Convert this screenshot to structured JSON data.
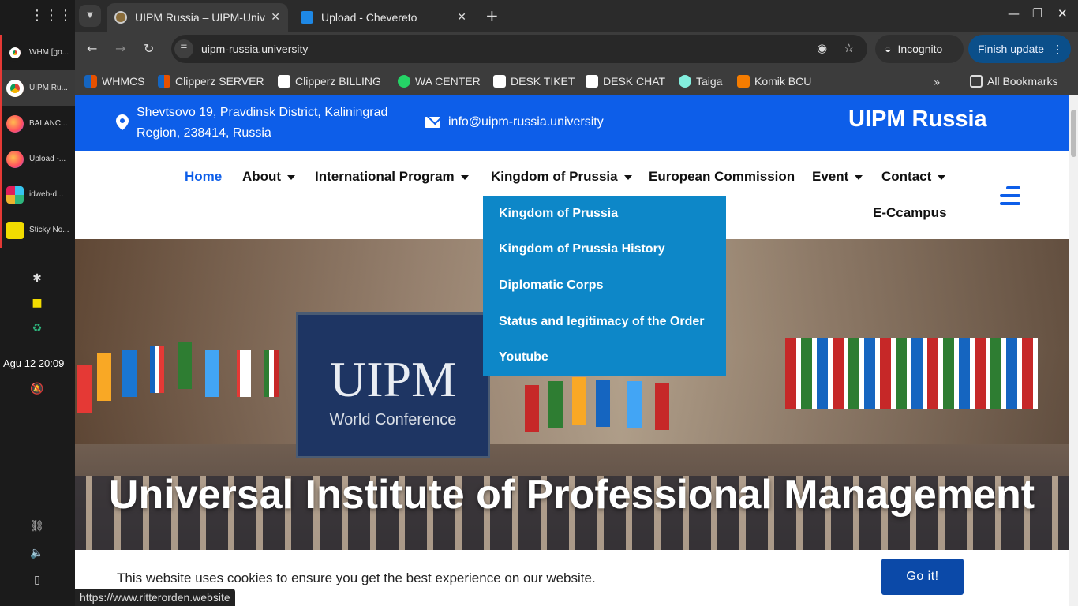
{
  "taskbar": {
    "items": [
      {
        "label": "WHM [go...",
        "color": "#d93025"
      },
      {
        "label": "UIPM Ru...",
        "color": "#1a73e8"
      },
      {
        "label": "BALANC...",
        "color": "#ff7139"
      },
      {
        "label": "Upload -...",
        "color": "#ff7139"
      },
      {
        "label": "idweb-d...",
        "color": "#611f69"
      },
      {
        "label": "Sticky No...",
        "color": "#f2dc00"
      }
    ],
    "clock": "Agu 12  20:09"
  },
  "browser": {
    "tabs": [
      {
        "title": "UIPM Russia – UIPM-Univ",
        "favicon": "uipm-icon"
      },
      {
        "title": "Upload - Chevereto",
        "favicon": "chevereto-icon"
      }
    ],
    "url": "uipm-russia.university",
    "incognito_label": "Incognito",
    "finish_update_label": "Finish update",
    "bookmarks": [
      {
        "label": "WHMCS",
        "color": "#e65100"
      },
      {
        "label": "Clipperz SERVER",
        "color": "#e65100"
      },
      {
        "label": "Clipperz BILLING",
        "color": "#ffffff"
      },
      {
        "label": "WA CENTER",
        "color": "#25d366"
      },
      {
        "label": "DESK TIKET",
        "color": "#ffffff"
      },
      {
        "label": "DESK CHAT",
        "color": "#ffffff"
      },
      {
        "label": "Taiga",
        "color": "#83eede"
      },
      {
        "label": "Komik BCU",
        "color": "#f57c00"
      }
    ],
    "all_bookmarks_label": "All Bookmarks",
    "status_url": "https://www.ritterorden.website"
  },
  "site": {
    "address": "Shevtsovo 19, Pravdinsk District, Kaliningrad Region, 238414, Russia",
    "email": "info@uipm-russia.university",
    "brand": "UIPM Russia",
    "nav": [
      {
        "label": "Home",
        "active": true
      },
      {
        "label": "About"
      },
      {
        "label": "International Program"
      },
      {
        "label": "Kingdom of Prussia"
      },
      {
        "label": "European Commission"
      },
      {
        "label": "Event"
      },
      {
        "label": "Contact"
      },
      {
        "label": "E-Ccampus"
      }
    ],
    "dropdown": [
      "Kingdom of Prussia",
      "Kingdom of Prussia History",
      "Diplomatic Corps",
      "Status and legitimacy of the Order",
      "Youtube"
    ],
    "hero": {
      "screen_title": "UIPM",
      "screen_subtitle": "World Conference",
      "title": "Universal Institute of Professional Management"
    },
    "cookie": {
      "text": "This website uses cookies to ensure you get the best experience on our website.",
      "button": "Go it!"
    },
    "colors": {
      "primary": "#0d5ee9",
      "dropdown": "#0d87c8",
      "cookie_button": "#0b49a8"
    }
  }
}
